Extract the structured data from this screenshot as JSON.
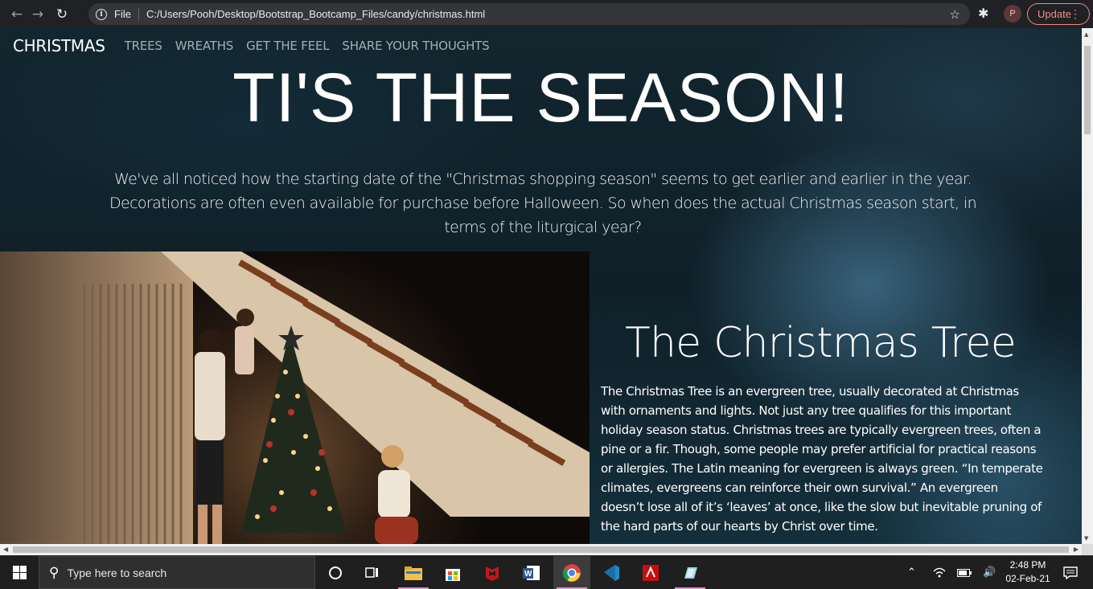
{
  "browser": {
    "scheme_label": "File",
    "url": "C:/Users/Pooh/Desktop/Bootstrap_Bootcamp_Files/candy/christmas.html",
    "profile_initial": "P",
    "update_label": "Update"
  },
  "navbar": {
    "brand": "CHRISTMAS",
    "links": [
      "TREES",
      "WREATHS",
      "GET THE FEEL",
      "SHARE YOUR THOUGHTS"
    ]
  },
  "hero": {
    "title": "TI'S THE SEASON!",
    "text": "We've all noticed how the starting date of the \"Christmas shopping season\" seems to get earlier and earlier in the year. Decorations are often even available for purchase before Halloween. So when does the actual Christmas season start, in terms of the liturgical year?"
  },
  "section": {
    "title": "The Christmas Tree",
    "text": "The Christmas Tree is an evergreen tree, usually decorated at Christmas with ornaments and lights. Not just any tree qualifies for this important holiday season status. Christmas trees are typically evergreen trees, often a pine or a fir. Though, some people may prefer artificial for practical reasons or allergies. The Latin meaning for evergreen is always green. “In temperate climates, evergreens can reinforce their own survival.” An evergreen doesn’t lose all of it’s ‘leaves’ at once, like the slow but inevitable pruning of the hard parts of our hearts by Christ over time."
  },
  "taskbar": {
    "search_placeholder": "Type here to search",
    "time": "2:48 PM",
    "date": "02-Feb-21",
    "apps": [
      "cortana-icon",
      "task-view-icon",
      "file-explorer-icon",
      "store-icon",
      "mcafee-icon",
      "word-icon",
      "chrome-icon",
      "vscode-icon",
      "acrobat-icon",
      "app-icon"
    ]
  }
}
